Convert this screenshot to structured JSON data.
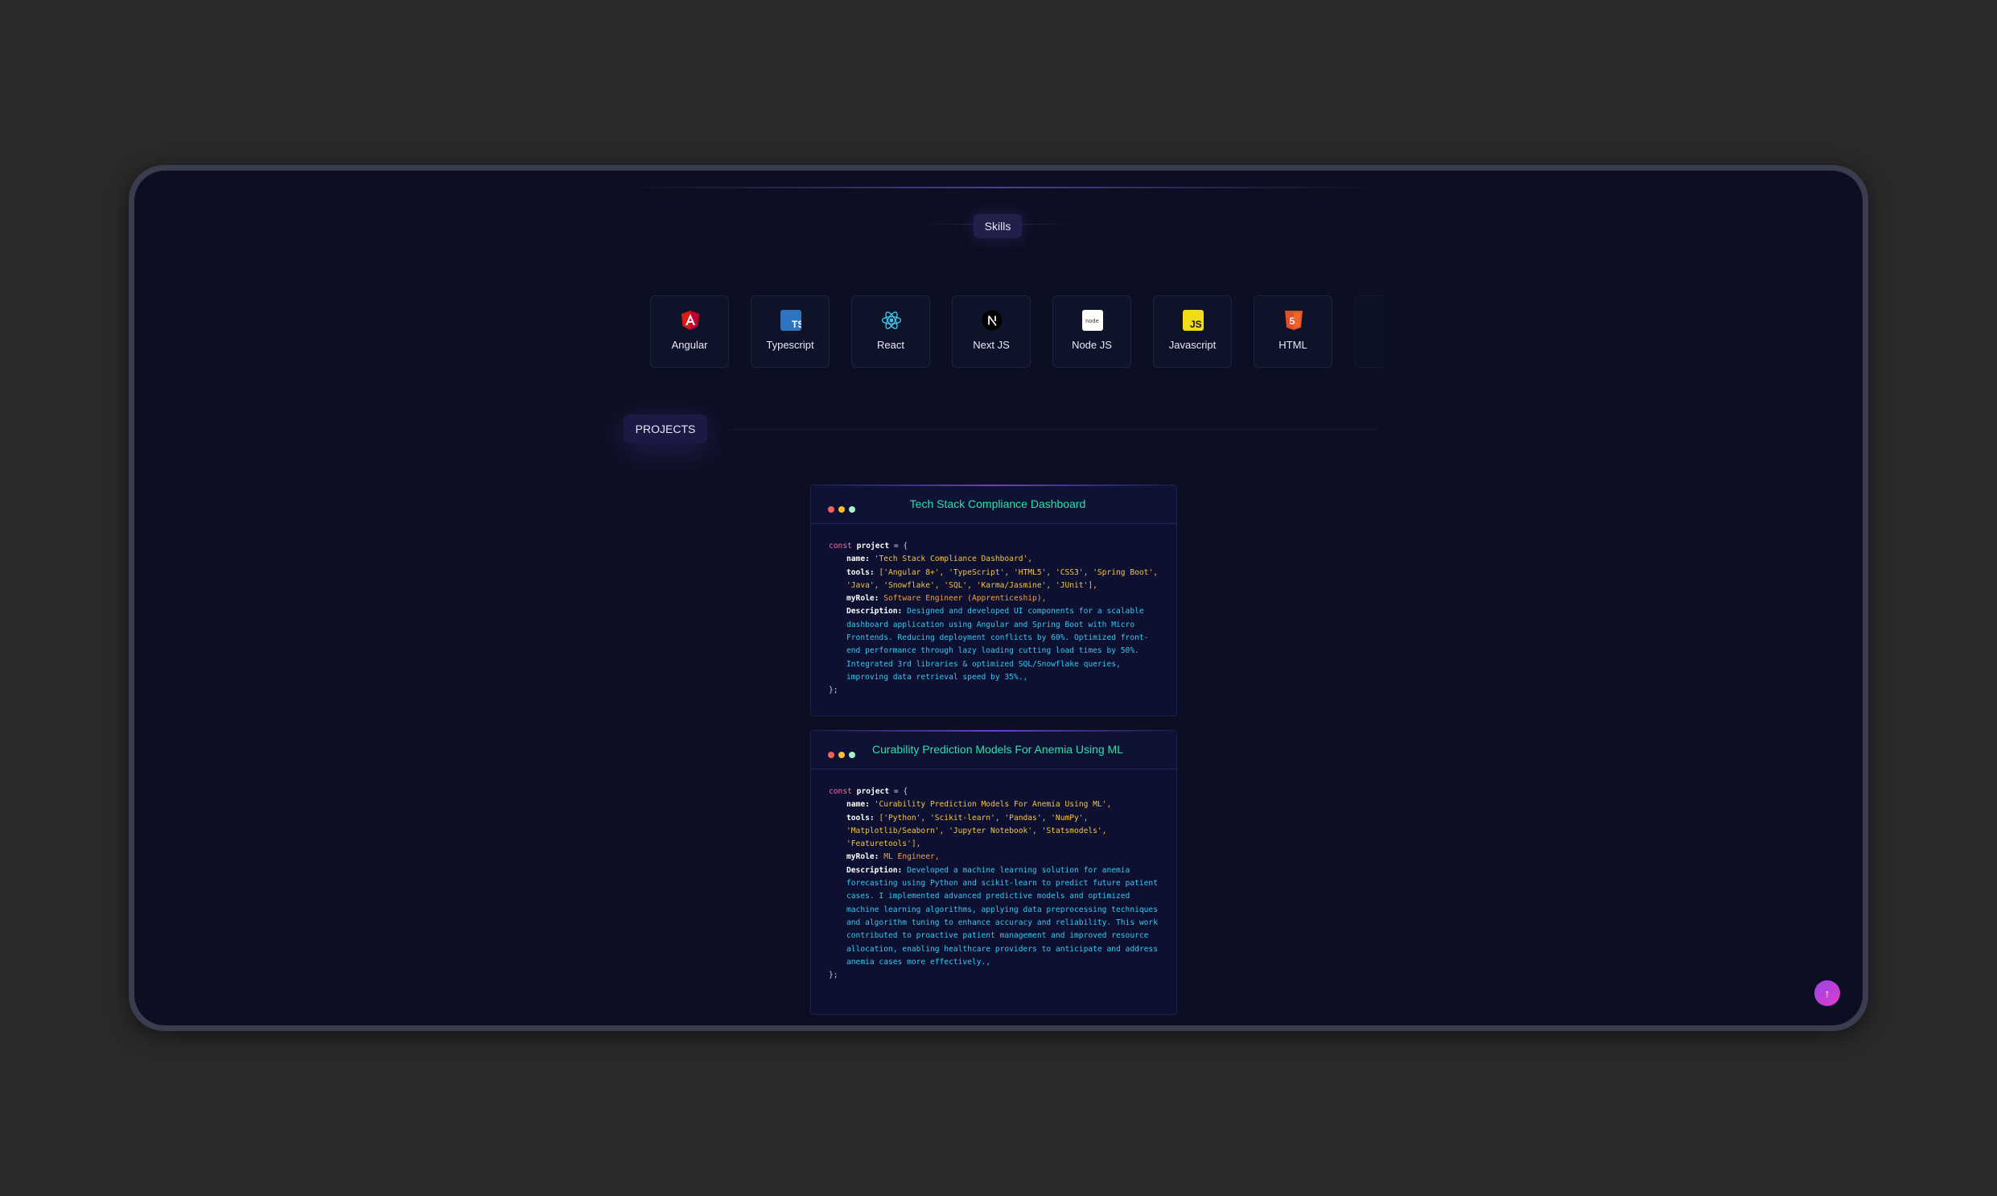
{
  "skills": {
    "title": "Skills",
    "items": [
      {
        "label": "Angular",
        "icon": "angular-icon"
      },
      {
        "label": "Typescript",
        "icon": "typescript-icon"
      },
      {
        "label": "React",
        "icon": "react-icon"
      },
      {
        "label": "Next JS",
        "icon": "nextjs-icon"
      },
      {
        "label": "Node JS",
        "icon": "nodejs-icon"
      },
      {
        "label": "Javascript",
        "icon": "javascript-icon"
      },
      {
        "label": "HTML",
        "icon": "html-icon"
      }
    ]
  },
  "projects": {
    "title": "PROJECTS",
    "items": [
      {
        "title": "Tech Stack Compliance Dashboard",
        "code": {
          "const_kw": "const",
          "var": "project",
          "open": " = {",
          "name_key": "name:",
          "name_val": "'Tech Stack Compliance Dashboard',",
          "tools_key": "tools:",
          "tools_val": "['Angular 8+', 'TypeScript', 'HTML5', 'CSS3', 'Spring Boot', 'Java', 'Snowflake', 'SQL', 'Karma/Jasmine', 'JUnit'],",
          "role_key": "myRole:",
          "role_val": "Software Engineer (Apprenticeship),",
          "desc_key": "Description:",
          "desc_val": "Designed and developed UI components for a scalable dashboard application using Angular and Spring Boot with Micro Frontends. Reducing deployment conflicts by 60%. Optimized front-end performance through lazy loading cutting load times by 50%. Integrated 3rd libraries & optimized SQL/Snowflake queries, improving data retrieval speed by 35%.,",
          "close": "};"
        }
      },
      {
        "title": "Curability Prediction Models For Anemia Using ML",
        "code": {
          "const_kw": "const",
          "var": "project",
          "open": " = {",
          "name_key": "name:",
          "name_val": "'Curability Prediction Models For Anemia Using ML',",
          "tools_key": "tools:",
          "tools_val": "['Python', 'Scikit-learn', 'Pandas', 'NumPy', 'Matplotlib/Seaborn', 'Jupyter Notebook', 'Statsmodels', 'Featuretools'],",
          "role_key": "myRole:",
          "role_val": "ML Engineer,",
          "desc_key": "Description:",
          "desc_val": "Developed a machine learning solution for anemia forecasting using Python and scikit-learn to predict future patient cases. I implemented advanced predictive models and optimized machine learning algorithms, applying data preprocessing techniques and algorithm tuning to enhance accuracy and reliability. This work contributed to proactive patient management and improved resource allocation, enabling healthcare providers to anticipate and address anemia cases more effectively.,",
          "close": "};"
        }
      }
    ]
  },
  "scroll_top": {
    "icon": "arrow-up-icon",
    "glyph": "↑"
  },
  "colors": {
    "background": "#2a2a2a",
    "screen": "#0c0f22",
    "accent_title": "#2ee0a8",
    "keyword": "#ff6b9e",
    "string": "#f5c542",
    "description": "#35c8f0",
    "dot_red": "#ff5f57",
    "dot_yellow": "#febc2e",
    "dot_green": "#a6f3c8"
  }
}
